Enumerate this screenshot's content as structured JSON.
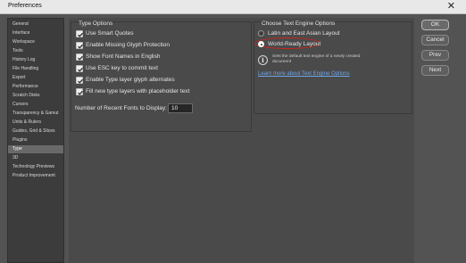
{
  "window": {
    "title": "Preferences",
    "close_glyph": "✕"
  },
  "sidebar": {
    "items": [
      {
        "label": "General"
      },
      {
        "label": "Interface"
      },
      {
        "label": "Workspace"
      },
      {
        "label": "Tools"
      },
      {
        "label": "History Log"
      },
      {
        "label": "File Handling"
      },
      {
        "label": "Export"
      },
      {
        "label": "Performance"
      },
      {
        "label": "Scratch Disks"
      },
      {
        "label": "Cursors"
      },
      {
        "label": "Transparency & Gamut"
      },
      {
        "label": "Units & Rulers"
      },
      {
        "label": "Guides, Grid & Slices"
      },
      {
        "label": "Plugins"
      },
      {
        "label": "Type"
      },
      {
        "label": "3D"
      },
      {
        "label": "Technology Previews"
      },
      {
        "label": "Product Improvement"
      }
    ],
    "selected": "Type"
  },
  "type_options": {
    "title": "Type Options",
    "checkboxes": [
      {
        "label": "Use Smart Quotes",
        "checked": true
      },
      {
        "label": "Enable Missing Glyph Protection",
        "checked": true
      },
      {
        "label": "Show Font Names in English",
        "checked": true
      },
      {
        "label": "Use ESC key to commit text",
        "checked": true
      },
      {
        "label": "Enable Type layer glyph alternates",
        "checked": true
      },
      {
        "label": "Fill new type layers with placeholder text",
        "checked": true
      }
    ],
    "recent_fonts_label": "Number of Recent Fonts to Display:",
    "recent_fonts_value": "10"
  },
  "text_engine": {
    "title": "Choose Text Engine Options",
    "options": [
      {
        "label": "Latin and East Asian Layout",
        "selected": false
      },
      {
        "label": "World-Ready Layout",
        "selected": true
      }
    ],
    "info_text": "Sets the default text engine of a newly created document",
    "learn_more": "Learn more about Text Engine Options",
    "highlight_color": "#c9261e"
  },
  "buttons": {
    "ok": "OK",
    "cancel": "Cancel",
    "prev": "Prev",
    "next": "Next"
  },
  "colors": {
    "panel_background": "#535353",
    "sidebar_background": "#3c3c3c",
    "selected_item": "#696969",
    "link": "#6ea7e8"
  }
}
